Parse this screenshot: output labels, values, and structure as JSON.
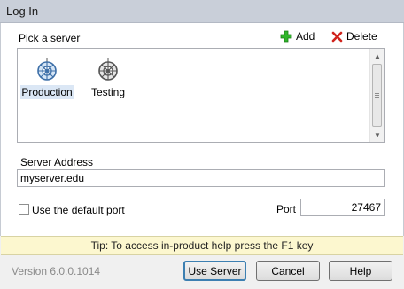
{
  "window": {
    "title": "Log In"
  },
  "servers": {
    "label": "Pick a server",
    "add_label": "Add",
    "delete_label": "Delete",
    "items": [
      {
        "label": "Production",
        "selected": true
      },
      {
        "label": "Testing",
        "selected": false
      }
    ]
  },
  "server_address": {
    "label": "Server Address",
    "value": "myserver.edu"
  },
  "port": {
    "default_checkbox_label": "Use the default port",
    "default_checked": false,
    "label": "Port",
    "value": "27467"
  },
  "tip": {
    "text": "Tip: To access in-product help press the F1 key"
  },
  "footer": {
    "version": "Version 6.0.0.1014",
    "use_server": "Use Server",
    "cancel": "Cancel",
    "help": "Help"
  },
  "colors": {
    "accent": "#3c7fb1",
    "tip_bg": "#fcf7cf",
    "selected_bg": "#dbe7f5"
  }
}
